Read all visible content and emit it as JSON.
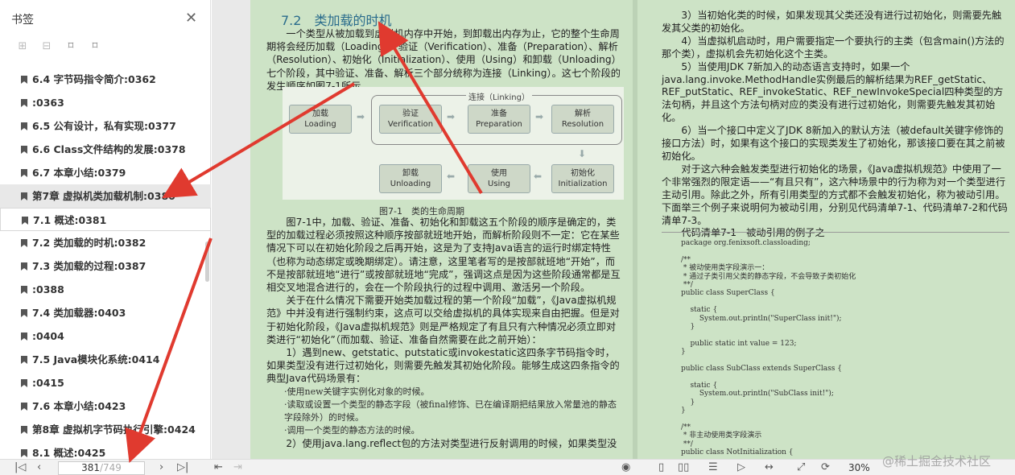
{
  "sidebar": {
    "title": "书签",
    "close_icon": "close-icon",
    "toc": [
      {
        "label": "6.4 字节码指令简介:0362"
      },
      {
        "label": ":0363"
      },
      {
        "label": "6.5 公有设计，私有实现:0377"
      },
      {
        "label": "6.6 Class文件结构的发展:0378"
      },
      {
        "label": "6.7 本章小结:0379"
      },
      {
        "label": "第7章 虚拟机类加载机制:0380"
      },
      {
        "label": "7.1 概述:0381"
      },
      {
        "label": "7.2 类加载的时机:0382"
      },
      {
        "label": "7.3 类加载的过程:0387"
      },
      {
        "label": ":0388"
      },
      {
        "label": "7.4 类加载器:0403"
      },
      {
        "label": ":0404"
      },
      {
        "label": "7.5 Java模块化系统:0414"
      },
      {
        "label": ":0415"
      },
      {
        "label": "7.6 本章小结:0423"
      },
      {
        "label": "第8章 虚拟机字节码执行引擎:0424"
      },
      {
        "label": "8.1 概述:0425"
      }
    ]
  },
  "page1": {
    "section_number": "7.2",
    "section_title": "类加载的时机",
    "intro": "一个类型从被加载到虚拟机内存中开始，到卸载出内存为止，它的整个生命周期将会经历加载（Loading）、验证（Verification）、准备（Preparation）、解析（Resolution）、初始化（Initialization）、使用（Using）和卸载（Unloading）七个阶段，其中验证、准备、解析三个部分统称为连接（Linking）。这七个阶段的发生顺序如图7-1所示。",
    "figure": {
      "link_label": "连接（Linking）",
      "stages": [
        {
          "cn": "加载",
          "en": "Loading"
        },
        {
          "cn": "验证",
          "en": "Verification"
        },
        {
          "cn": "准备",
          "en": "Preparation"
        },
        {
          "cn": "解析",
          "en": "Resolution"
        },
        {
          "cn": "初始化",
          "en": "Initialization"
        },
        {
          "cn": "使用",
          "en": "Using"
        },
        {
          "cn": "卸载",
          "en": "Unloading"
        }
      ],
      "caption": "图7-1　类的生命周期"
    },
    "para2": "图7-1中，加载、验证、准备、初始化和卸载这五个阶段的顺序是确定的，类型的加载过程必须按照这种顺序按部就班地开始，而解析阶段则不一定：它在某些情况下可以在初始化阶段之后再开始，这是为了支持Java语言的运行时绑定特性（也称为动态绑定或晚期绑定）。请注意，这里笔者写的是按部就班地“开始”，而不是按部就班地“进行”或按部就班地“完成”，强调这点是因为这些阶段通常都是互相交叉地混合进行的，会在一个阶段执行的过程中调用、激活另一个阶段。",
    "para3": "关于在什么情况下需要开始类加载过程的第一个阶段“加载”，《Java虚拟机规范》中并没有进行强制约束，这点可以交给虚拟机的具体实现来自由把握。但是对于初始化阶段，《Java虚拟机规范》则是严格规定了有且只有六种情况必须立即对类进行“初始化”（而加载、验证、准备自然需要在此之前开始）：",
    "para4": "1）遇到new、getstatic、putstatic或invokestatic这四条字节码指令时，如果类型没有进行过初始化，则需要先触发其初始化阶段。能够生成这四条指令的典型Java代码场景有：",
    "bullet1": "·使用new关键字实例化对象的时候。",
    "bullet2": "·读取或设置一个类型的静态字段（被final修饰、已在编译期把结果放入常量池的静态字段除外）的时候。",
    "bullet3": "·调用一个类型的静态方法的时候。",
    "para5": "2）使用java.lang.reflect包的方法对类型进行反射调用的时候，如果类型没"
  },
  "page2": {
    "p1": "3）当初始化类的时候，如果发现其父类还没有进行过初始化，则需要先触发其父类的初始化。",
    "p2": "4）当虚拟机启动时，用户需要指定一个要执行的主类（包含main()方法的那个类），虚拟机会先初始化这个主类。",
    "p3": "5）当使用JDK 7新加入的动态语言支持时，如果一个java.lang.invoke.MethodHandle实例最后的解析结果为REF_getStatic、REF_putStatic、REF_invokeStatic、REF_newInvokeSpecial四种类型的方法句柄，并且这个方法句柄对应的类没有进行过初始化，则需要先触发其初始化。",
    "p4": "6）当一个接口中定义了JDK 8新加入的默认方法（被default关键字修饰的接口方法）时，如果有这个接口的实现类发生了初始化，那该接口要在其之前被初始化。",
    "p5": "对于这六种会触发类型进行初始化的场景，《Java虚拟机规范》中使用了一个非常强烈的限定语——“有且只有”，这六种场景中的行为称为对一个类型进行主动引用。除此之外，所有引用类型的方式都不会触发初始化，称为被动引用。下面举三个例子来说明何为被动引用，分别见代码清单7-1、代码清单7-2和代码清单7-3。",
    "listing_title": "代码清单7-1　被动引用的例子之一",
    "code": "package org.fenixsoft.classloading;\n\n/**\n * 被动使用类字段演示一：\n * 通过子类引用父类的静态字段，不会导致子类初始化\n **/\npublic class SuperClass {\n\n    static {\n        System.out.println(\"SuperClass init!\");\n    }\n\n    public static int value = 123;\n}\n\npublic class SubClass extends SuperClass {\n\n    static {\n        System.out.println(\"SubClass init!\");\n    }\n}\n\n/**\n * 非主动使用类字段演示\n **/\npublic class NotInitialization {"
  },
  "bottombar": {
    "current_page": "381",
    "total_pages": "/749",
    "zoom": "30%"
  },
  "watermark": "@稀土掘金技术社区",
  "colors": {
    "page_bg": "#cde3c6",
    "section_title": "#2a6c8c",
    "arrow": "#e03a2f"
  }
}
